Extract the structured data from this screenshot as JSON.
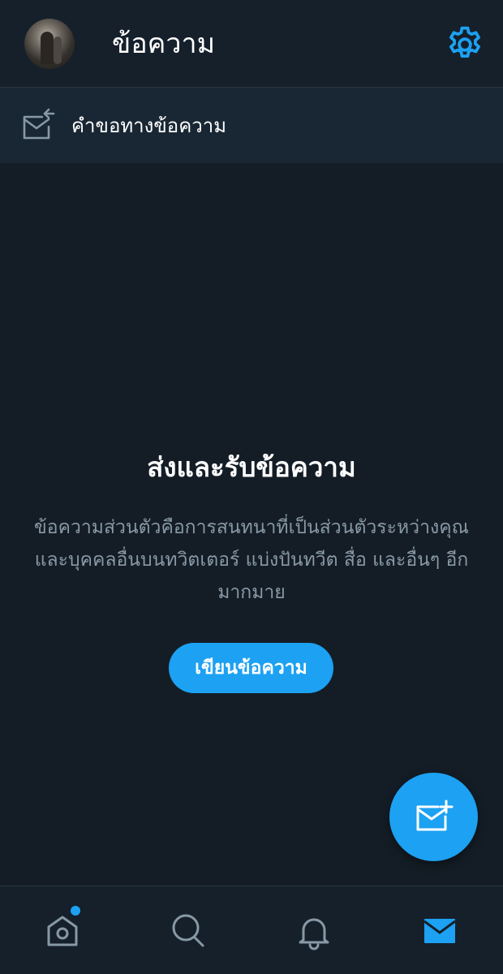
{
  "header": {
    "title": "ข้อความ",
    "avatar_icon": "user-avatar",
    "settings_icon": "gear-icon"
  },
  "message_requests": {
    "label": "คำขอทางข้อความ",
    "icon": "envelope-arrow-icon"
  },
  "empty_state": {
    "title": "ส่งและรับข้อความ",
    "description": "ข้อความส่วนตัวคือการสนทนาที่เป็นส่วนตัวระหว่างคุณและบุคคลอื่นบนทวิตเตอร์ แบ่งปันทวีต สื่อ และอื่นๆ อีกมากมาย",
    "button_label": "เขียนข้อความ"
  },
  "fab": {
    "icon": "new-message-icon"
  },
  "bottom_nav": {
    "items": [
      {
        "name": "home",
        "icon": "home-icon",
        "has_notification_dot": true
      },
      {
        "name": "search",
        "icon": "search-icon"
      },
      {
        "name": "notifications",
        "icon": "bell-icon"
      },
      {
        "name": "messages",
        "icon": "mail-icon",
        "active": true
      }
    ]
  },
  "colors": {
    "background": "#141d26",
    "header": "#15202b",
    "row": "#192734",
    "accent": "#1da1f2",
    "muted_text": "#8899a6"
  }
}
